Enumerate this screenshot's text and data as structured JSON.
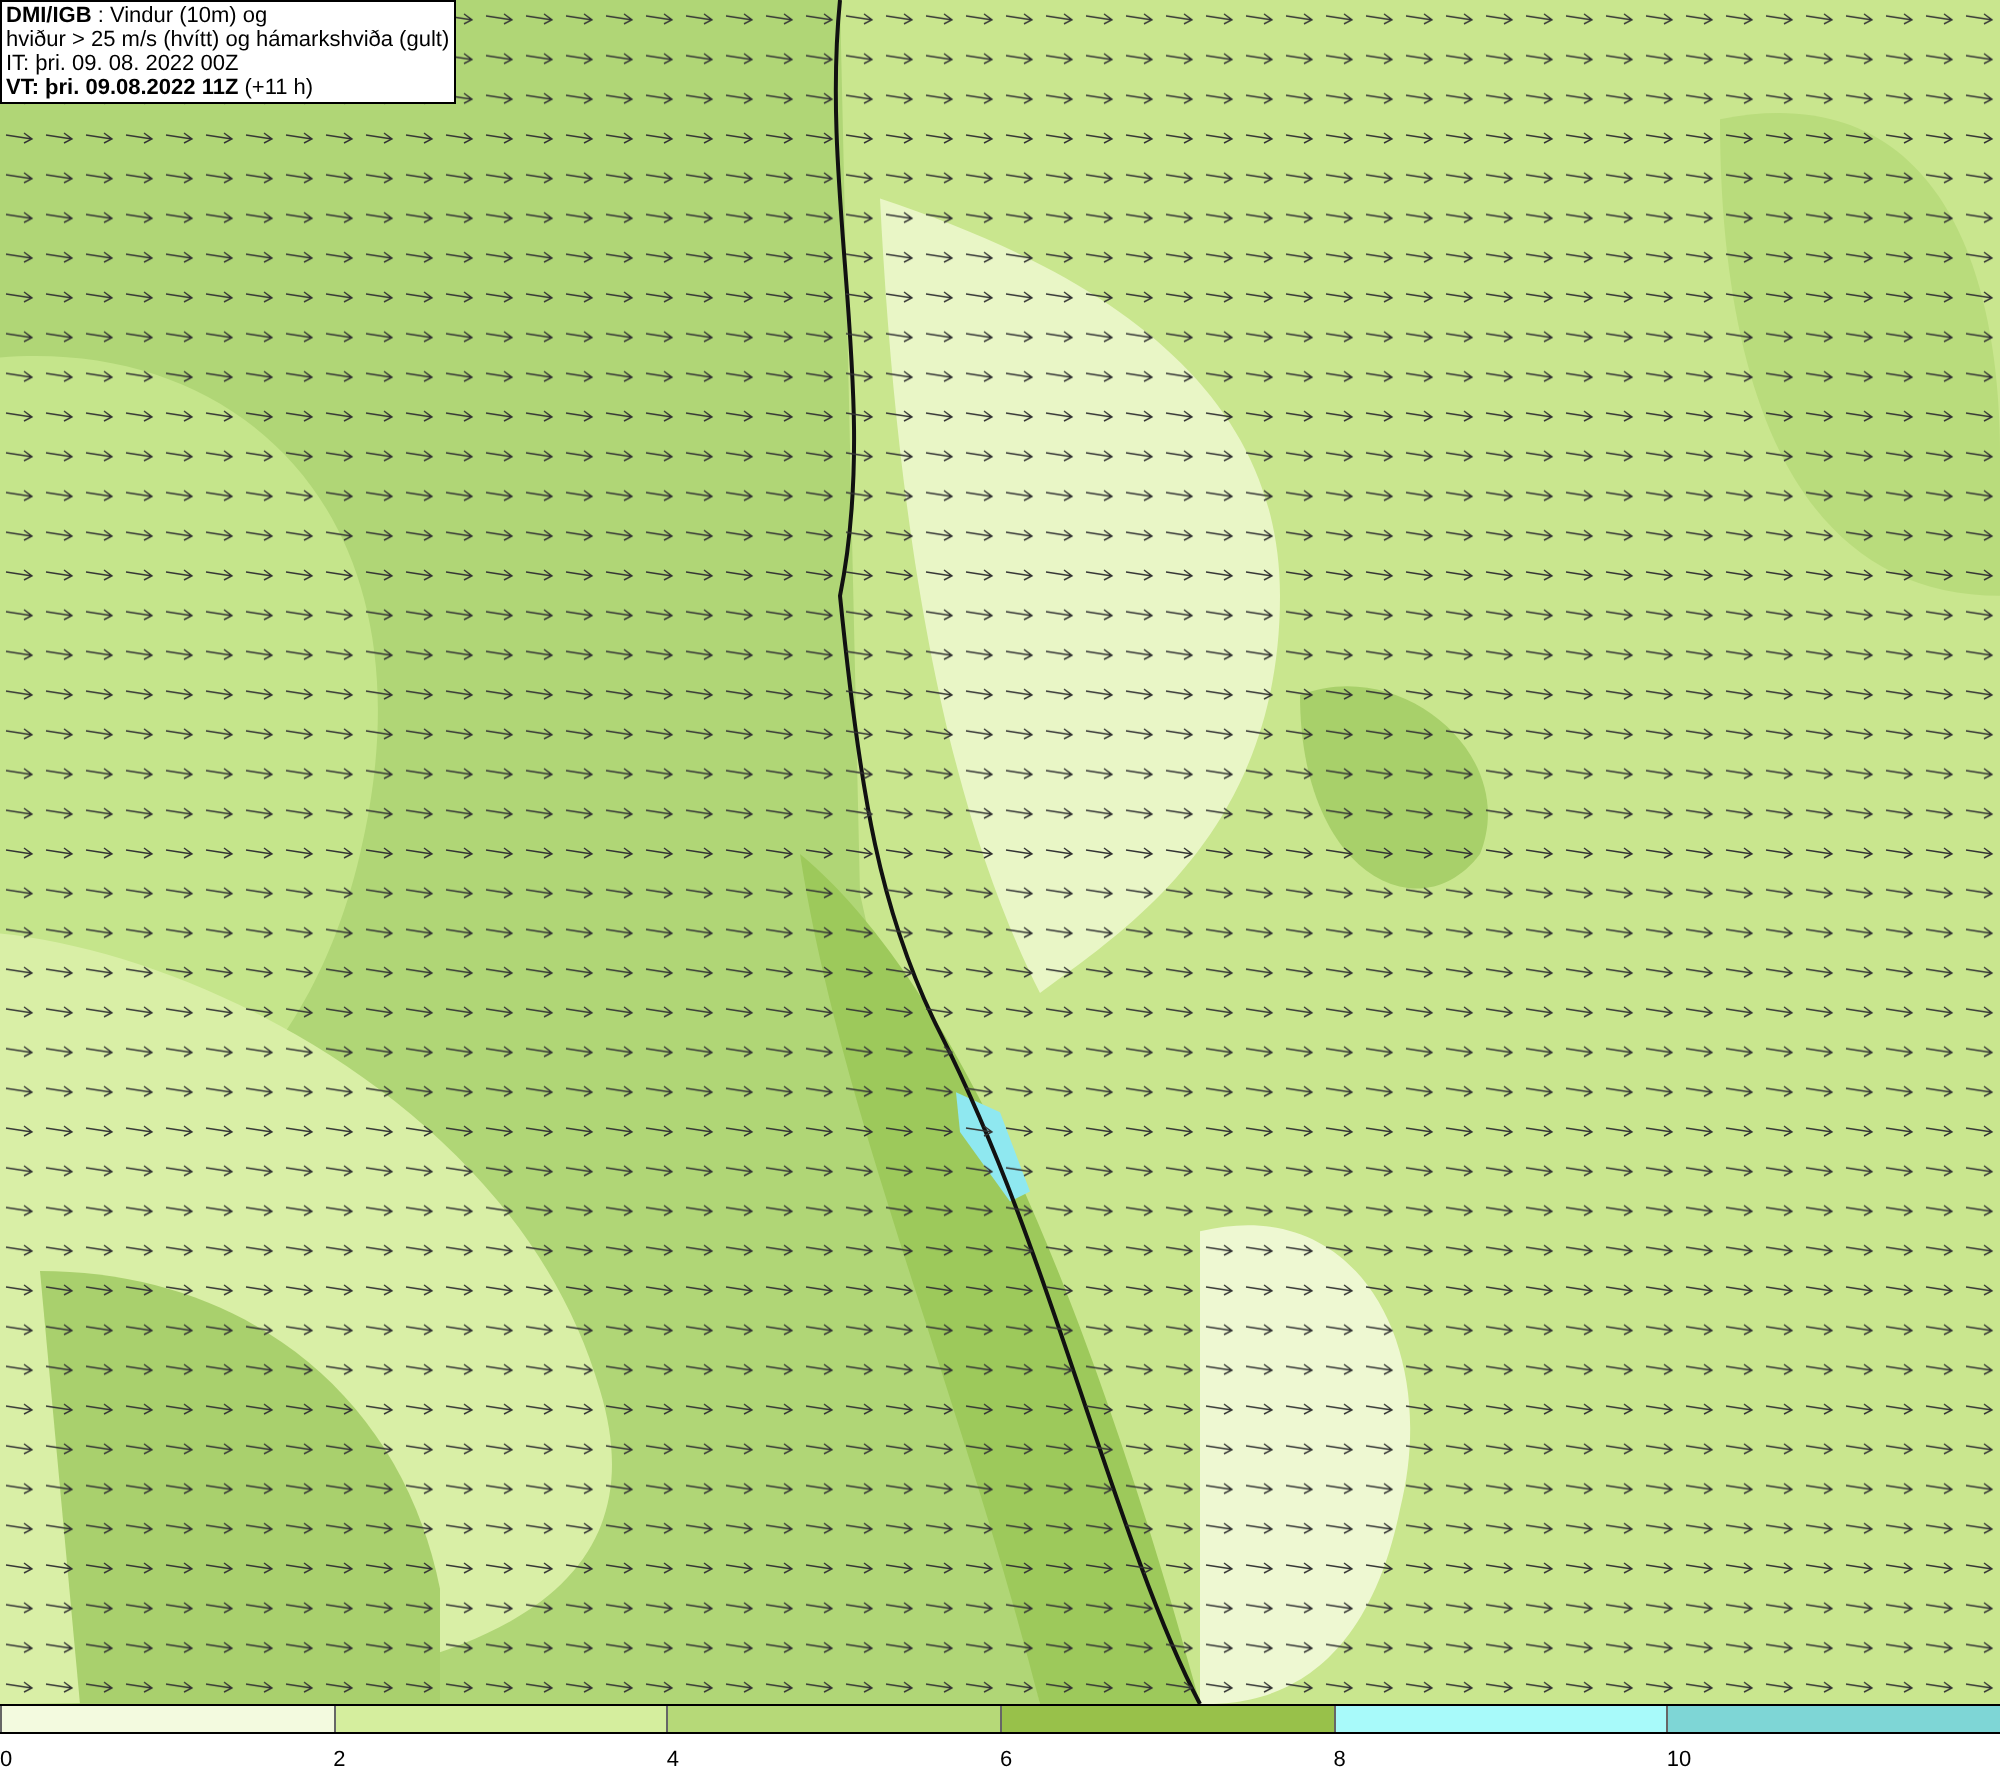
{
  "header": {
    "lines": [
      "**DMI/IGB** : Vindur (10m) og",
      "hviður > 25 m/s (hvítt) og hámarkshviða (gult)",
      "IT: þri. 09. 08. 2022 00Z",
      "**VT: þri. 09.08.2022 11Z** (+11 h)"
    ]
  },
  "legend": [
    {
      "label": "0",
      "color": "#f3fadf"
    },
    {
      "label": "2",
      "color": "#d5ee9e"
    },
    {
      "label": "4",
      "color": "#b6d978"
    },
    {
      "label": "6",
      "color": "#98c14a"
    },
    {
      "label": "8",
      "color": "#a8fafa"
    },
    {
      "label": "10",
      "color": "#7ed6d6"
    }
  ]
}
